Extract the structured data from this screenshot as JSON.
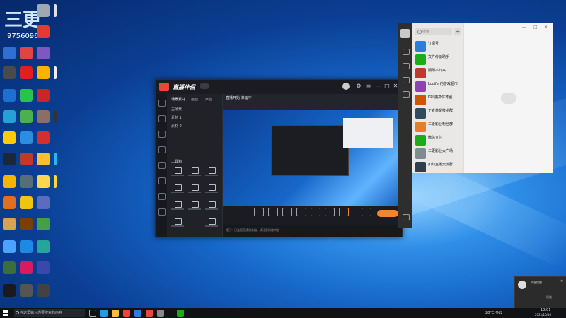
{
  "desktop": {
    "overlay_badge": "三更",
    "overlay_id": "9756096"
  },
  "app": {
    "title": "直播伴侣",
    "panel_tabs": [
      "场景素材",
      "画面",
      "声音"
    ],
    "panel_rows": [
      "主场景",
      "素材 1",
      "素材 2"
    ],
    "tools_heading": "工具箱",
    "scene_title": "直播开始 准备中",
    "live_button": "开始直播",
    "status_text": "提示：已连接直播服务器，请注意网络状态"
  },
  "chat": {
    "search_placeholder": "搜索",
    "plus": "+",
    "items": [
      {
        "title": "订阅号",
        "sub": "",
        "color": "#2a7de1"
      },
      {
        "title": "文件传输助手",
        "sub": "",
        "color": "#1aad19"
      },
      {
        "title": "阴阳不归来",
        "sub": "",
        "color": "#c0392b"
      },
      {
        "title": "Lucifer的游戏超市",
        "sub": "",
        "color": "#8e44ad"
      },
      {
        "title": "KPL魔高体育圈",
        "sub": "",
        "color": "#d35400"
      },
      {
        "title": "王者荣耀技术群",
        "sub": "",
        "color": "#34495e"
      },
      {
        "title": "三更影业粉丝群",
        "sub": "",
        "color": "#e67e22"
      },
      {
        "title": "微信支付",
        "sub": "",
        "color": "#1aad19"
      },
      {
        "title": "三更影业大广场",
        "sub": "",
        "color": "#7f8c8d"
      },
      {
        "title": "如幻直播交流群",
        "sub": "",
        "color": "#2c3e50"
      }
    ],
    "controls": [
      "—",
      "□",
      "✕"
    ]
  },
  "notification": {
    "title": "消息提醒",
    "meta": "刚刚",
    "close": "✕"
  },
  "taskbar": {
    "search_placeholder": "在这里输入你要搜索的内容",
    "weather": "28°C 多云",
    "time": "19:01",
    "date": "2021/10/16"
  },
  "colors": {
    "accent_orange": "#f5842a",
    "wechat_green": "#1aad19",
    "app_bg": "#1d1f24"
  }
}
